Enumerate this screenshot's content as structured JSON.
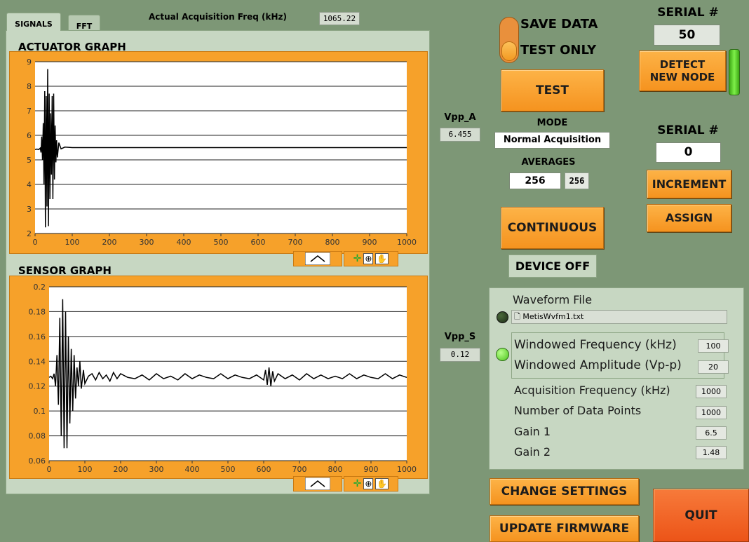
{
  "tabs": [
    {
      "label": "SIGNALS"
    },
    {
      "label": "FFT"
    }
  ],
  "acq_freq": {
    "label": "Actual Acquisition Freq (kHz)",
    "value": "1065.22"
  },
  "chart_data": [
    {
      "type": "line",
      "title": "ACTUATOR GRAPH",
      "xlim": [
        0,
        1000
      ],
      "ylim": [
        2,
        9
      ],
      "x_ticks": [
        "0",
        "100",
        "200",
        "300",
        "400",
        "500",
        "600",
        "700",
        "800",
        "900",
        "1000"
      ],
      "y_ticks": [
        "2",
        "3",
        "4",
        "5",
        "6",
        "7",
        "8",
        "9"
      ],
      "series": [
        {
          "x": [
            0,
            5,
            10,
            14,
            16,
            18,
            20,
            22,
            24,
            26,
            28,
            30,
            32,
            34,
            36,
            38,
            40,
            42,
            44,
            46,
            48,
            50,
            52,
            54,
            56,
            58,
            60,
            64,
            70,
            80,
            100,
            1000
          ],
          "y": [
            5.42,
            5.44,
            5.42,
            5.48,
            5.3,
            5.95,
            5.0,
            6.5,
            4.0,
            7.8,
            2.25,
            7.6,
            3.1,
            8.7,
            2.3,
            7.7,
            3.4,
            6.9,
            4.4,
            7.6,
            3.4,
            7.7,
            4.2,
            6.4,
            4.9,
            5.8,
            5.1,
            5.7,
            5.45,
            5.52,
            5.5,
            5.5
          ]
        }
      ]
    },
    {
      "type": "line",
      "title": "SENSOR GRAPH",
      "xlim": [
        0,
        1000
      ],
      "ylim": [
        0.06,
        0.2
      ],
      "x_ticks": [
        "0",
        "100",
        "200",
        "300",
        "400",
        "500",
        "600",
        "700",
        "800",
        "900",
        "1000"
      ],
      "y_ticks": [
        "0.06",
        "0.08",
        "0.1",
        "0.12",
        "0.14",
        "0.16",
        "0.18",
        "0.2"
      ],
      "series": [
        {
          "x": [
            0,
            5,
            10,
            14,
            18,
            22,
            26,
            30,
            34,
            38,
            42,
            46,
            50,
            54,
            58,
            62,
            66,
            70,
            74,
            78,
            82,
            86,
            90,
            96,
            100,
            110,
            120,
            130,
            140,
            150,
            160,
            170,
            180,
            190,
            200,
            220,
            240,
            260,
            280,
            300,
            320,
            340,
            360,
            380,
            400,
            420,
            440,
            460,
            480,
            500,
            520,
            540,
            560,
            580,
            600,
            605,
            610,
            615,
            620,
            625,
            630,
            640,
            660,
            680,
            700,
            720,
            740,
            760,
            780,
            800,
            820,
            840,
            860,
            880,
            900,
            920,
            940,
            960,
            980,
            1000
          ],
          "y": [
            0.127,
            0.128,
            0.126,
            0.13,
            0.12,
            0.145,
            0.105,
            0.175,
            0.08,
            0.19,
            0.07,
            0.18,
            0.07,
            0.16,
            0.09,
            0.15,
            0.1,
            0.145,
            0.11,
            0.135,
            0.12,
            0.14,
            0.118,
            0.133,
            0.122,
            0.128,
            0.13,
            0.125,
            0.131,
            0.126,
            0.129,
            0.124,
            0.131,
            0.126,
            0.13,
            0.127,
            0.126,
            0.129,
            0.125,
            0.13,
            0.126,
            0.128,
            0.125,
            0.13,
            0.126,
            0.129,
            0.127,
            0.126,
            0.13,
            0.126,
            0.129,
            0.127,
            0.126,
            0.129,
            0.125,
            0.133,
            0.121,
            0.135,
            0.12,
            0.132,
            0.124,
            0.13,
            0.126,
            0.129,
            0.125,
            0.13,
            0.126,
            0.129,
            0.126,
            0.128,
            0.126,
            0.13,
            0.126,
            0.129,
            0.127,
            0.126,
            0.13,
            0.126,
            0.129,
            0.127
          ]
        }
      ]
    }
  ],
  "vpp_a": {
    "label": "Vpp_A",
    "value": "6.455"
  },
  "vpp_s": {
    "label": "Vpp_S",
    "value": "0.12"
  },
  "save_switch": {
    "save_label": "SAVE DATA",
    "test_label": "TEST ONLY"
  },
  "test_button": "TEST",
  "mode": {
    "label": "MODE",
    "value": "Normal Acquisition"
  },
  "averages": {
    "label": "AVERAGES",
    "value": "256",
    "indicator": "256"
  },
  "continuous_button": "CONTINUOUS",
  "device_status": "DEVICE OFF",
  "serial_top": {
    "label": "SERIAL #",
    "value": "50"
  },
  "detect_button": "DETECT NEW NODE",
  "serial_bottom": {
    "label": "SERIAL #",
    "value": "0"
  },
  "increment_button": "INCREMENT",
  "assign_button": "ASSIGN",
  "waveform": {
    "title": "Waveform File",
    "file": "MetisWvfm1.txt",
    "windowed_freq_label": "Windowed Frequency (kHz)",
    "windowed_freq": "100",
    "windowed_amp_label": "Windowed Amplitude (Vp-p)",
    "windowed_amp": "20",
    "acq_freq_label": "Acquisition Frequency (kHz)",
    "acq_freq": "1000",
    "points_label": "Number of Data Points",
    "points": "1000",
    "gain1_label": "Gain 1",
    "gain1": "6.5",
    "gain2_label": "Gain 2",
    "gain2": "1.48"
  },
  "change_settings_button": "CHANGE SETTINGS",
  "update_firmware_button": "UPDATE FIRMWARE",
  "quit_button": "QUIT",
  "colors": {
    "accent": "#f6a12a",
    "quit": "#f05a1e",
    "led_green": "#5fd32a"
  }
}
